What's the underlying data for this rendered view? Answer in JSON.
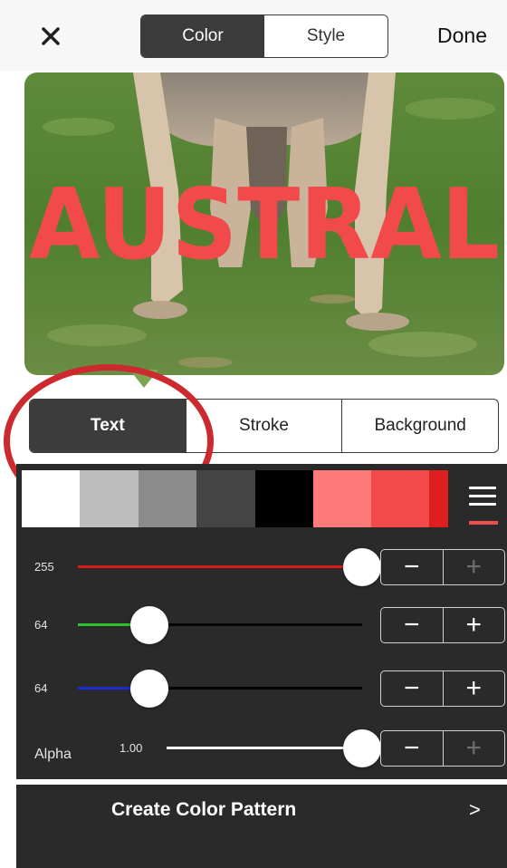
{
  "header": {
    "close_icon": "close-icon",
    "segments": [
      "Color",
      "Style"
    ],
    "active_segment": "Color",
    "done_label": "Done"
  },
  "preview": {
    "overlay_text": "AUSTRAL",
    "text_color": "#f24a4a"
  },
  "target_tabs": {
    "items": [
      "Text",
      "Stroke",
      "Background"
    ],
    "active": "Text"
  },
  "annotation": {
    "type": "circle",
    "color": "#cc2a2e"
  },
  "swatches": {
    "colors": [
      "#ffffff",
      "#bdbdbd",
      "#8c8c8c",
      "#444444",
      "#000000",
      "#ff7a7a",
      "#f24a4a",
      "#dd1f1f"
    ],
    "menu_icon": "hamburger-icon",
    "accent": "#ef4e4e"
  },
  "sliders": {
    "red": {
      "label": "255",
      "value": 255,
      "max": 255,
      "color": "#d61b1b"
    },
    "green": {
      "label": "64",
      "value": 64,
      "max": 255,
      "color": "#2ec12e"
    },
    "blue": {
      "label": "64",
      "value": 64,
      "max": 255,
      "color": "#1b2bd1"
    },
    "alpha": {
      "label": "Alpha",
      "value_text": "1.00",
      "value": 1.0,
      "max": 1.0,
      "color": "#ffffff"
    },
    "minus_glyph": "−",
    "plus_glyph": "+"
  },
  "pattern": {
    "label": "Create Color Pattern",
    "chevron": ">"
  }
}
